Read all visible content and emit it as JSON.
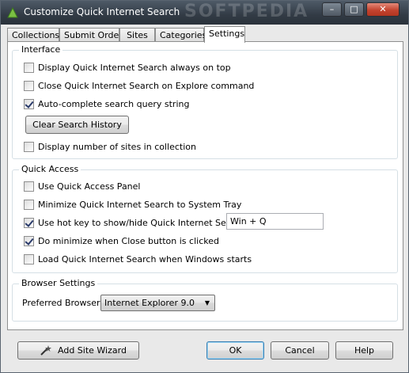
{
  "window": {
    "title": "Customize Quick Internet Search",
    "watermark": "SOFTPEDIA",
    "controls": {
      "minimize": "–",
      "maximize": "□",
      "close": "✕"
    }
  },
  "tabs": [
    {
      "label": "Collections",
      "active": false
    },
    {
      "label": "Submit Order",
      "active": false
    },
    {
      "label": "Sites",
      "active": false
    },
    {
      "label": "Categories",
      "active": false
    },
    {
      "label": "Settings",
      "active": true
    }
  ],
  "interface": {
    "title": "Interface",
    "always_on_top": {
      "label": "Display Quick Internet Search always on top",
      "checked": false
    },
    "close_on_explore": {
      "label": "Close Quick Internet Search on Explore command",
      "checked": false
    },
    "autocomplete": {
      "label": "Auto-complete search query string",
      "checked": true
    },
    "clear_history_label": "Clear Search History",
    "display_count": {
      "label": "Display number of sites in collection",
      "checked": false
    }
  },
  "quick_access": {
    "title": "Quick Access",
    "use_panel": {
      "label": "Use Quick Access Panel",
      "checked": false
    },
    "minimize_tray": {
      "label": "Minimize Quick Internet Search to System Tray",
      "checked": false
    },
    "hotkey": {
      "label": "Use hot key to show/hide Quick Internet Search:",
      "checked": true,
      "value": "Win + Q"
    },
    "minimize_on_close": {
      "label": "Do minimize when Close button is clicked",
      "checked": true
    },
    "load_on_start": {
      "label": "Load Quick Internet Search when Windows starts",
      "checked": false
    }
  },
  "browser_settings": {
    "title": "Browser Settings",
    "preferred_label": "Preferred Browser:",
    "preferred_value": "Internet Explorer 9.0"
  },
  "footer": {
    "add_site_wizard": "Add Site Wizard",
    "ok": "OK",
    "cancel": "Cancel",
    "help": "Help"
  }
}
